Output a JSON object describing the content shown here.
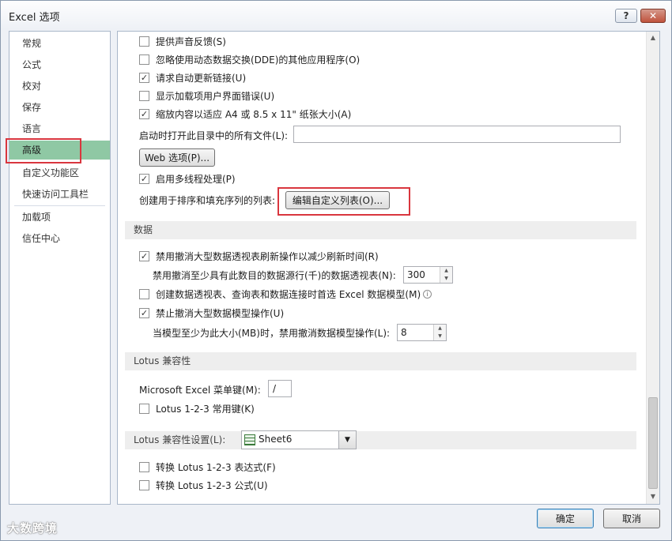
{
  "window": {
    "title": "Excel 选项",
    "help_label": "?",
    "close_label": "✕"
  },
  "nav": {
    "items": [
      {
        "label": "常规"
      },
      {
        "label": "公式"
      },
      {
        "label": "校对"
      },
      {
        "label": "保存"
      },
      {
        "label": "语言"
      },
      {
        "label": "高级",
        "selected": true
      },
      {
        "label": "自定义功能区"
      },
      {
        "label": "快速访问工具栏"
      },
      {
        "label": "加载项"
      },
      {
        "label": "信任中心"
      }
    ]
  },
  "general": {
    "sound_feedback": {
      "label": "提供声音反馈(S)",
      "checked": false
    },
    "ignore_dde": {
      "label": "忽略使用动态数据交换(DDE)的其他应用程序(O)",
      "checked": false
    },
    "update_links": {
      "label": "请求自动更新链接(U)",
      "checked": true
    },
    "show_addin_errors": {
      "label": "显示加载项用户界面错误(U)",
      "checked": false
    },
    "scale_content": {
      "label": "缩放内容以适应 A4 或 8.5 x 11\" 纸张大小(A)",
      "checked": true
    },
    "startup_open_label": "启动时打开此目录中的所有文件(L):",
    "startup_open_value": "",
    "web_options_label": "Web 选项(P)...",
    "multithread": {
      "label": "启用多线程处理(P)",
      "checked": true
    },
    "custom_lists_label": "创建用于排序和填充序列的列表:",
    "edit_custom_lists_label": "编辑自定义列表(O)..."
  },
  "data_section": {
    "heading": "数据",
    "disable_undo_pivot": {
      "label": "禁用撤消大型数据透视表刷新操作以减少刷新时间(R)",
      "checked": true
    },
    "pivot_rows_label": "禁用撤消至少具有此数目的数据源行(千)的数据透视表(N):",
    "pivot_rows_value": "300",
    "prefer_data_model": {
      "label": "创建数据透视表、查询表和数据连接时首选 Excel 数据模型(M)",
      "checked": false
    },
    "info_label": "i",
    "disable_undo_model": {
      "label": "禁止撤消大型数据模型操作(U)",
      "checked": true
    },
    "model_size_label": "当模型至少为此大小(MB)时，禁用撤消数据模型操作(L):",
    "model_size_value": "8"
  },
  "lotus_section": {
    "heading": "Lotus 兼容性",
    "menu_key_label": "Microsoft Excel 菜单键(M):",
    "menu_key_value": "/",
    "lotus_nav_keys": {
      "label": "Lotus 1-2-3 常用键(K)",
      "checked": false
    }
  },
  "lotus_settings": {
    "heading": "Lotus 兼容性设置(L):",
    "sheet_value": "Sheet6",
    "transition_eval": {
      "label": "转换 Lotus 1-2-3 表达式(F)",
      "checked": false
    },
    "transition_entry": {
      "label": "转换 Lotus 1-2-3 公式(U)",
      "checked": false
    }
  },
  "footer": {
    "ok_label": "确定",
    "cancel_label": "取消",
    "watermark_text": "大数跨境"
  },
  "colors": {
    "selected_nav_bg": "#8fc8a4",
    "highlight_red": "#d9363e",
    "section_bg": "#eeeeee"
  }
}
